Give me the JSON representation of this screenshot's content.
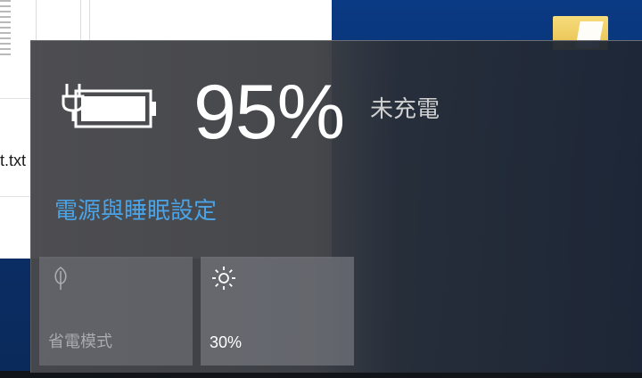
{
  "background": {
    "file_label": "t.txt"
  },
  "battery": {
    "percent": "95%",
    "status": "未充電",
    "settings_link": "電源與睡眠設定"
  },
  "quick_actions": {
    "battery_saver_label": "省電模式",
    "brightness_label": "30%",
    "battery_saver_icon": "battery-saver-leaf-icon",
    "brightness_icon": "brightness-sun-icon"
  },
  "colors": {
    "accent_link": "#4aa3e6",
    "flyout_bg": "#46484c",
    "text_primary": "#ffffff"
  }
}
